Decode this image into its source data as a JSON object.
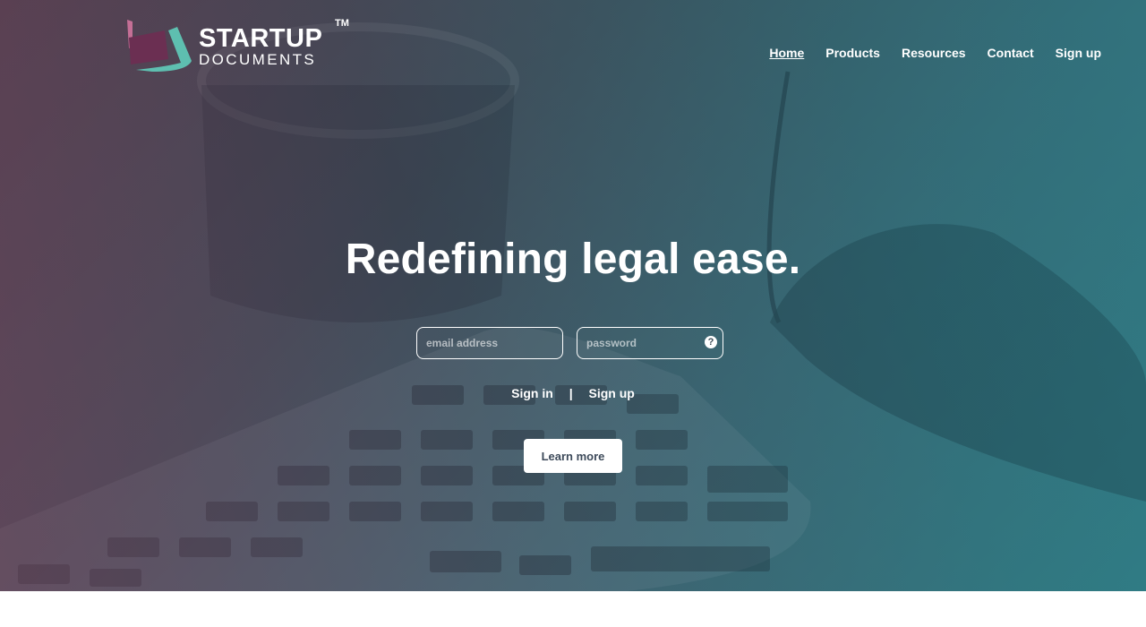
{
  "brand": {
    "title": "STARTUP",
    "tm": "TM",
    "subtitle": "DOCUMENTS",
    "colors": {
      "mark_purple": "#6b2f52",
      "mark_pink": "#c56f96",
      "mark_teal": "#5ebfb0"
    }
  },
  "nav": {
    "items": [
      {
        "label": "Home",
        "active": true
      },
      {
        "label": "Products",
        "active": false
      },
      {
        "label": "Resources",
        "active": false
      },
      {
        "label": "Contact",
        "active": false
      },
      {
        "label": "Sign up",
        "active": false
      }
    ]
  },
  "hero": {
    "headline": "Redefining legal ease.",
    "email_placeholder": "email address",
    "password_placeholder": "password",
    "help_glyph": "?",
    "sign_in_label": "Sign in",
    "separator": "|",
    "sign_up_label": "Sign up",
    "learn_more_label": "Learn more",
    "background": "photo-desk-keyboard-mug-hand-mouse"
  }
}
